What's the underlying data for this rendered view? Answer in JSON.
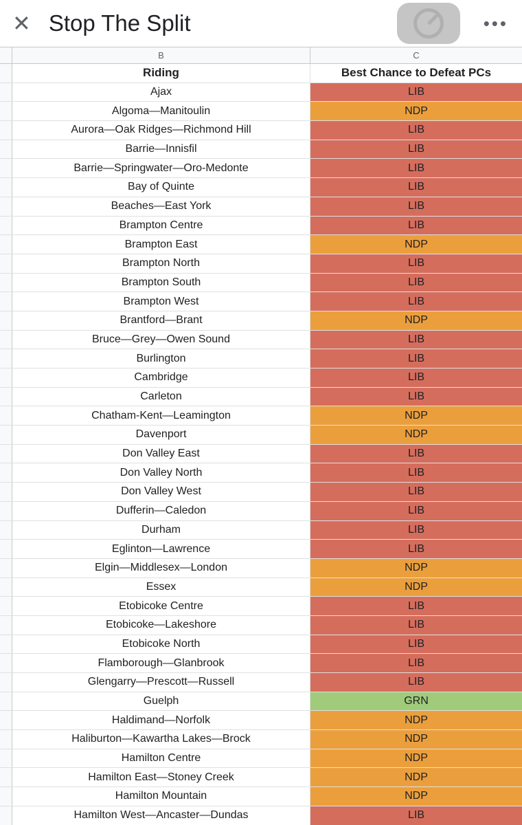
{
  "header": {
    "title": "Stop The Split"
  },
  "columns": {
    "b_letter": "B",
    "c_letter": "C",
    "riding_header": "Riding",
    "party_header": "Best Chance to Defeat PCs"
  },
  "rows": [
    {
      "riding": "Ajax",
      "party": "LIB"
    },
    {
      "riding": "Algoma—Manitoulin",
      "party": "NDP"
    },
    {
      "riding": "Aurora—Oak Ridges—Richmond Hill",
      "party": "LIB"
    },
    {
      "riding": "Barrie—Innisfil",
      "party": "LIB"
    },
    {
      "riding": "Barrie—Springwater—Oro-Medonte",
      "party": "LIB"
    },
    {
      "riding": "Bay of Quinte",
      "party": "LIB"
    },
    {
      "riding": "Beaches—East York",
      "party": "LIB"
    },
    {
      "riding": "Brampton Centre",
      "party": "LIB"
    },
    {
      "riding": "Brampton East",
      "party": "NDP"
    },
    {
      "riding": "Brampton North",
      "party": "LIB"
    },
    {
      "riding": "Brampton South",
      "party": "LIB"
    },
    {
      "riding": "Brampton West",
      "party": "LIB"
    },
    {
      "riding": "Brantford—Brant",
      "party": "NDP"
    },
    {
      "riding": "Bruce—Grey—Owen Sound",
      "party": "LIB"
    },
    {
      "riding": "Burlington",
      "party": "LIB"
    },
    {
      "riding": "Cambridge",
      "party": "LIB"
    },
    {
      "riding": "Carleton",
      "party": "LIB"
    },
    {
      "riding": "Chatham-Kent—Leamington",
      "party": "NDP"
    },
    {
      "riding": "Davenport",
      "party": "NDP"
    },
    {
      "riding": "Don Valley East",
      "party": "LIB"
    },
    {
      "riding": "Don Valley North",
      "party": "LIB"
    },
    {
      "riding": "Don Valley West",
      "party": "LIB"
    },
    {
      "riding": "Dufferin—Caledon",
      "party": "LIB"
    },
    {
      "riding": "Durham",
      "party": "LIB"
    },
    {
      "riding": "Eglinton—Lawrence",
      "party": "LIB"
    },
    {
      "riding": "Elgin—Middlesex—London",
      "party": "NDP"
    },
    {
      "riding": "Essex",
      "party": "NDP"
    },
    {
      "riding": "Etobicoke Centre",
      "party": "LIB"
    },
    {
      "riding": "Etobicoke—Lakeshore",
      "party": "LIB"
    },
    {
      "riding": "Etobicoke North",
      "party": "LIB"
    },
    {
      "riding": "Flamborough—Glanbrook",
      "party": "LIB"
    },
    {
      "riding": "Glengarry—Prescott—Russell",
      "party": "LIB"
    },
    {
      "riding": "Guelph",
      "party": "GRN"
    },
    {
      "riding": "Haldimand—Norfolk",
      "party": "NDP"
    },
    {
      "riding": "Haliburton—Kawartha Lakes—Brock",
      "party": "NDP"
    },
    {
      "riding": "Hamilton Centre",
      "party": "NDP"
    },
    {
      "riding": "Hamilton East—Stoney Creek",
      "party": "NDP"
    },
    {
      "riding": "Hamilton Mountain",
      "party": "NDP"
    },
    {
      "riding": "Hamilton West—Ancaster—Dundas",
      "party": "LIB"
    }
  ]
}
